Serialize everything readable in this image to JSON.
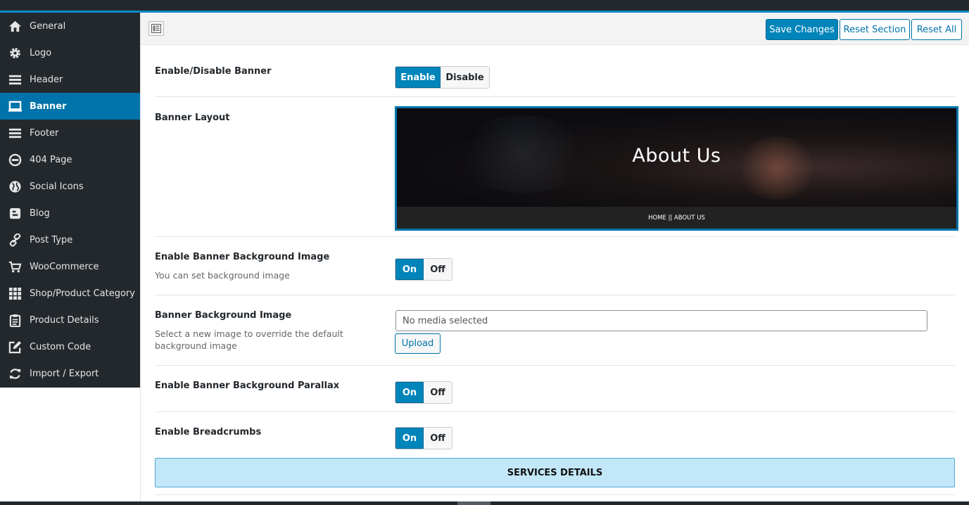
{
  "sidebar": {
    "items": [
      {
        "label": "General",
        "icon": "home-icon"
      },
      {
        "label": "Logo",
        "icon": "gear-icon"
      },
      {
        "label": "Header",
        "icon": "menu-icon"
      },
      {
        "label": "Banner",
        "icon": "laptop-icon",
        "active": true
      },
      {
        "label": "Footer",
        "icon": "menu-icon"
      },
      {
        "label": "404 Page",
        "icon": "minus-circle-icon"
      },
      {
        "label": "Social Icons",
        "icon": "globe-icon"
      },
      {
        "label": "Blog",
        "icon": "blogger-icon"
      },
      {
        "label": "Post Type",
        "icon": "link-icon"
      },
      {
        "label": "WooCommerce",
        "icon": "cart-icon"
      },
      {
        "label": "Shop/Product Category",
        "icon": "grid-icon"
      },
      {
        "label": "Product Details",
        "icon": "clipboard-icon"
      },
      {
        "label": "Custom Code",
        "icon": "edit-icon"
      },
      {
        "label": "Import / Export",
        "icon": "refresh-icon"
      }
    ]
  },
  "toolbar": {
    "save_label": "Save Changes",
    "reset_section_label": "Reset Section",
    "reset_all_label": "Reset All"
  },
  "fields": {
    "enable_banner": {
      "title": "Enable/Disable Banner",
      "on_label": "Enable",
      "off_label": "Disable",
      "value": "Enable"
    },
    "banner_layout": {
      "title": "Banner Layout",
      "preview_title": "About Us",
      "preview_breadcrumb": "HOME  ||  ABOUT US"
    },
    "enable_bg_image": {
      "title": "Enable Banner Background Image",
      "desc": "You can set background image",
      "on_label": "On",
      "off_label": "Off",
      "value": "On"
    },
    "bg_image": {
      "title": "Banner Background Image",
      "desc": "Select a new image to override the default background image",
      "placeholder": "No media selected",
      "upload_label": "Upload"
    },
    "parallax": {
      "title": "Enable Banner Background Parallax",
      "on_label": "On",
      "off_label": "Off",
      "value": "On"
    },
    "breadcrumbs": {
      "title": "Enable Breadcrumbs",
      "on_label": "On",
      "off_label": "Off",
      "value": "On"
    }
  },
  "section": {
    "title": "SERVICES DETAILS"
  },
  "colors": {
    "accent": "#0085ba",
    "sidebar_bg": "#23282d",
    "active_item": "#0073aa",
    "section_bg": "#c2e7f8"
  }
}
